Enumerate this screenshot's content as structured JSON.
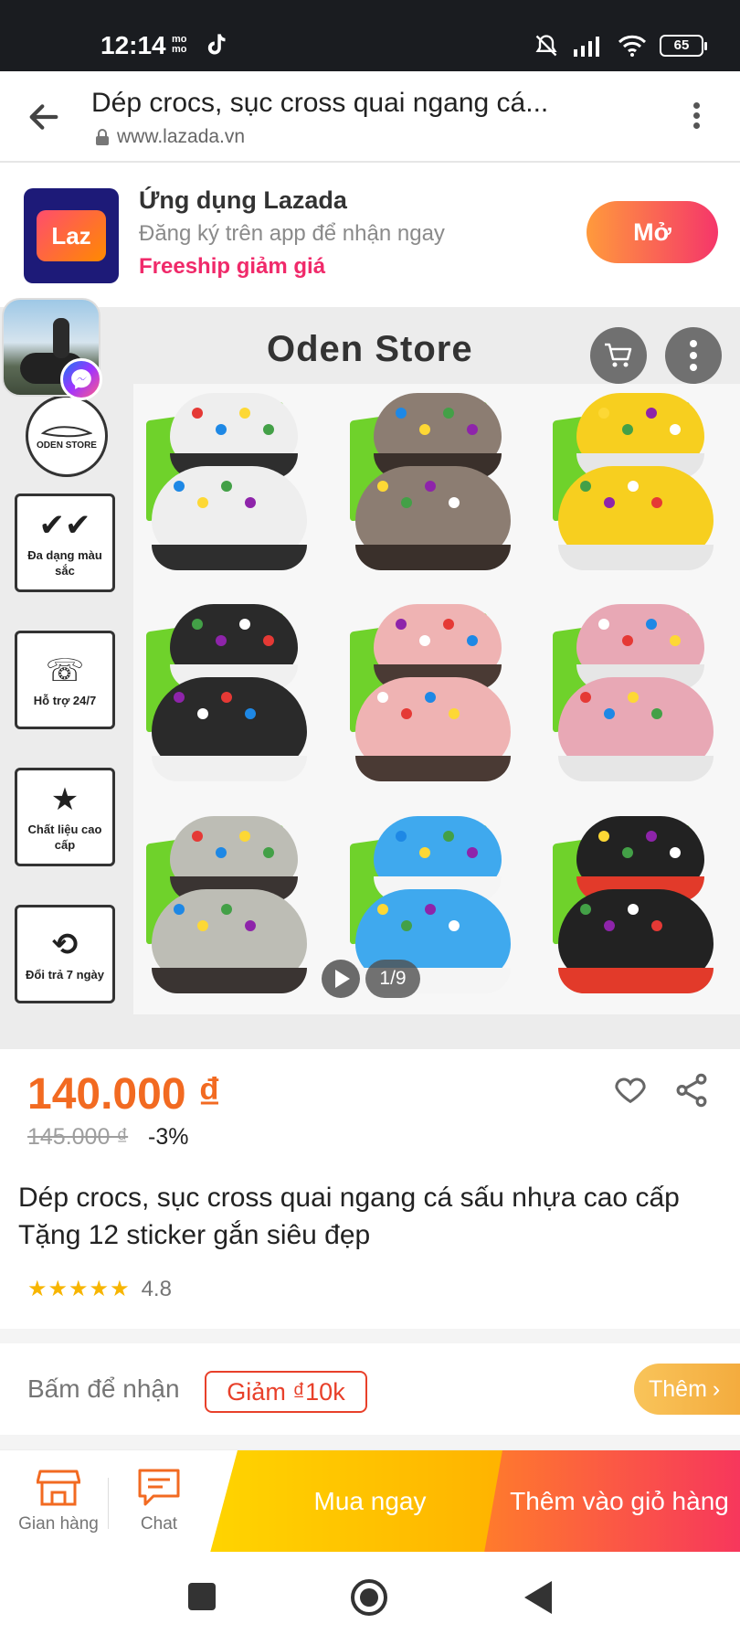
{
  "status_bar": {
    "time": "12:14",
    "momo": "mo mo",
    "battery": "65"
  },
  "browser": {
    "page_title": "Dép crocs, sục cross quai ngang cá...",
    "domain": "www.lazada.vn"
  },
  "app_banner": {
    "logo_text": "Laz",
    "title": "Ứng dụng Lazada",
    "subtitle": "Đăng ký trên app để nhận ngay",
    "promo": "Freeship giảm giá",
    "open_label": "Mở"
  },
  "product_image": {
    "store_name": "Oden Store",
    "features": [
      {
        "label": "Đa dạng màu sắc",
        "icon": "double-check-icon"
      },
      {
        "label": "Hỗ trợ 24/7",
        "icon": "phone-icon"
      },
      {
        "label": "Chất liệu cao cấp",
        "icon": "hand-stars-icon"
      },
      {
        "label": "Đổi trả 7 ngày",
        "icon": "return-icon"
      }
    ],
    "logo_text": "ODEN STORE",
    "counter": "1/9",
    "shoe_colors": [
      "#eeeeee",
      "#8c7d72",
      "#f7cf1f",
      "#2a2a2a",
      "#efb3b3",
      "#e8a8b5",
      "#bdbdb5",
      "#3fa9ee",
      "#222222"
    ],
    "sole_colors": [
      "#2e2e2e",
      "#3a302b",
      "#e6e6e6",
      "#f0f0f0",
      "#4a3a34",
      "#e6e6e6",
      "#3a3432",
      "#f5f5f5",
      "#e23a2a"
    ]
  },
  "price": {
    "current": "140.000 ₫",
    "original": "145.000 ₫",
    "discount": "-3%"
  },
  "product": {
    "title": "Dép crocs, sục cross quai ngang cá sấu nhựa cao cấp Tặng 12 sticker gắn siêu đẹp",
    "rating_stars": "★★★★★",
    "rating": "4.8"
  },
  "voucher": {
    "label": "Bấm để nhận",
    "chip": "Giảm ₫10k",
    "more": "Thêm"
  },
  "action_bar": {
    "store_label": "Gian hàng",
    "chat_label": "Chat",
    "buy_now": "Mua ngay",
    "add_to_cart": "Thêm vào giỏ hàng"
  },
  "colors": {
    "price": "#f26a21",
    "promo": "#f02a6a",
    "voucher": "#e8402a",
    "buy_now": "#ffc400",
    "add_to_cart": "#f7375c"
  }
}
